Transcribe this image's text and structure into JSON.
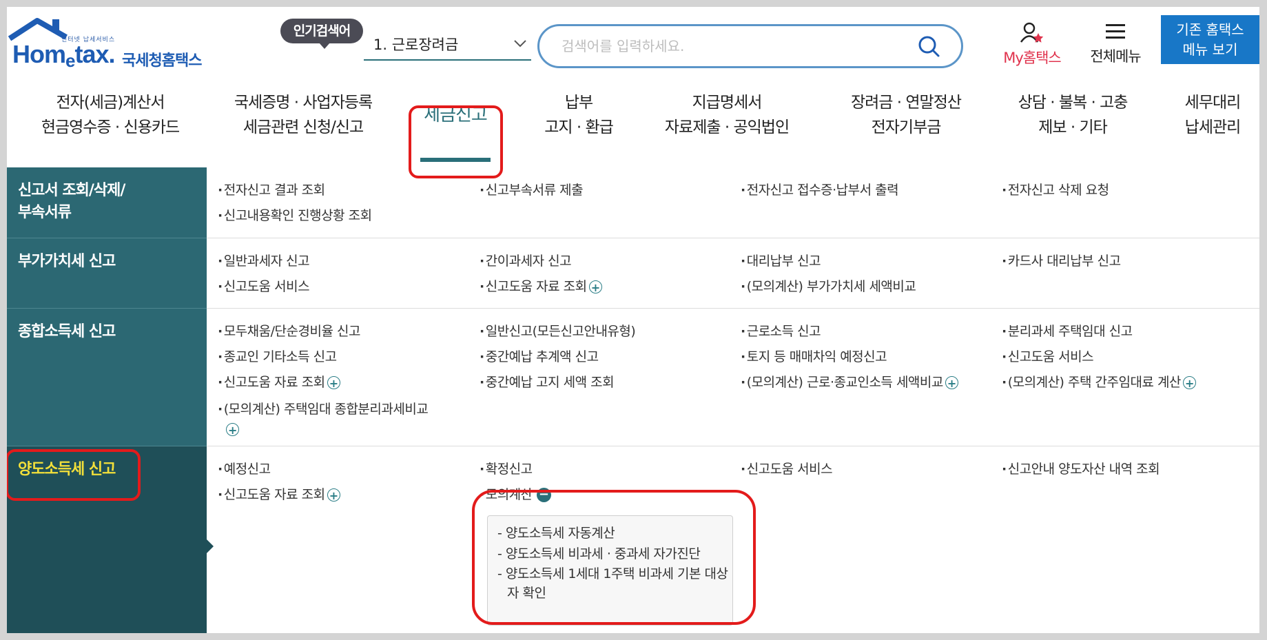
{
  "header": {
    "logo_small": "인터넷 납세서비스",
    "logo_main_a": "Hom",
    "logo_main_e": "e",
    "logo_main_b": "tax.",
    "logo_korean": "국세청홈택스",
    "popular_badge": "인기검색어",
    "popular_keyword": "1.  근로장려금",
    "search_placeholder": "검색어를 입력하세요.",
    "my_hometax": "My홈택스",
    "all_menu": "전체메뉴",
    "old_menu_line1": "기존 홈택스",
    "old_menu_line2": "메뉴 보기"
  },
  "gnb": [
    {
      "line1": "전자(세금)계산서",
      "line2": "현금영수증 · 신용카드"
    },
    {
      "line1": "국세증명 · 사업자등록",
      "line2": "세금관련 신청/신고"
    },
    {
      "line1": "세금신고",
      "line2": ""
    },
    {
      "line1": "납부",
      "line2": "고지 · 환급"
    },
    {
      "line1": "지급명세서",
      "line2": "자료제출 · 공익법인"
    },
    {
      "line1": "장려금 · 연말정산",
      "line2": "전자기부금"
    },
    {
      "line1": "상담 · 불복 · 고충",
      "line2": "제보 · 기타"
    },
    {
      "line1": "세무대리",
      "line2": "납세관리"
    }
  ],
  "sidebar": [
    {
      "line1": "신고서 조회/삭제/",
      "line2": "부속서류"
    },
    {
      "line1": "부가가치세 신고",
      "line2": ""
    },
    {
      "line1": "종합소득세 신고",
      "line2": ""
    },
    {
      "line1": "양도소득세 신고",
      "line2": ""
    }
  ],
  "sections": {
    "s1": [
      "전자신고 결과 조회",
      "신고부속서류 제출",
      "전자신고 접수증·납부서 출력",
      "전자신고 삭제 요청",
      "신고내용확인 진행상황 조회"
    ],
    "s2": [
      "일반과세자 신고",
      "간이과세자 신고",
      "대리납부 신고",
      "카드사 대리납부 신고",
      "신고도움 서비스",
      "신고도움 자료 조회",
      "(모의계산) 부가가치세 세액비교"
    ],
    "s3": [
      "모두채움/단순경비율 신고",
      "일반신고(모든신고안내유형)",
      "근로소득 신고",
      "분리과세 주택임대 신고",
      "종교인 기타소득 신고",
      "중간예납 추계액 신고",
      "토지 등 매매차익 예정신고",
      "신고도움 서비스",
      "신고도움 자료 조회",
      "중간예납 고지 세액 조회",
      "(모의계산) 근로·종교인소득 세액비교",
      "(모의계산) 주택 간주임대료 계산",
      "(모의계산) 주택임대 종합분리과세비교"
    ],
    "s4": [
      "예정신고",
      "확정신고",
      "신고도움 서비스",
      "신고안내 양도자산 내역 조회",
      "신고도움 자료 조회",
      "모의계산"
    ]
  },
  "submenu": [
    "- 양도소득세 자동계산",
    "- 양도소득세 비과세 · 중과세 자가진단",
    "- 양도소득세 1세대 1주택 비과세 기본 대상자 확인"
  ],
  "symbols": {
    "dot": "·",
    "plus": "+",
    "minus": "−"
  },
  "colors": {
    "accent": "#2c6873",
    "active_text": "#f3e03a",
    "highlight": "#e31b1b",
    "brand_blue": "#1877c7"
  }
}
